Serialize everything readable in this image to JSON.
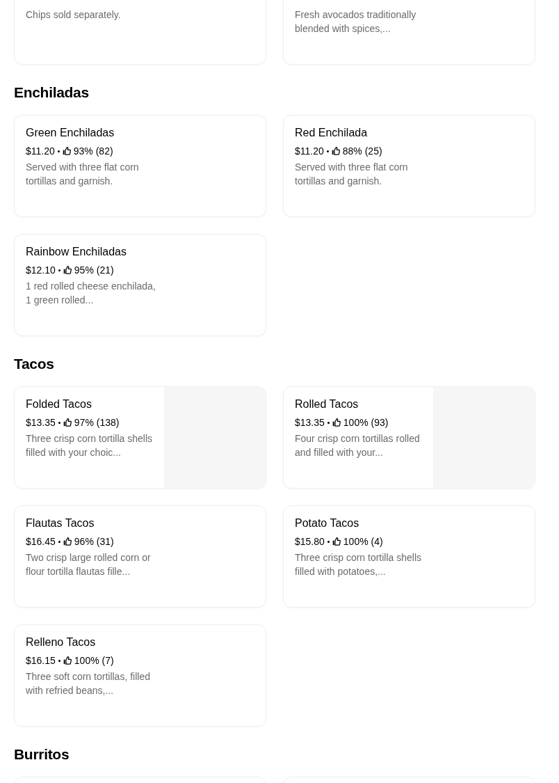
{
  "sections": [
    {
      "items": [
        {
          "description": "Chips sold separately.",
          "has_image": false
        },
        {
          "description": "Fresh avocados traditionally blended with spices,...",
          "has_image": false
        }
      ]
    },
    {
      "title": "Enchiladas",
      "items": [
        {
          "name": "Green Enchiladas",
          "price": "$11.20",
          "rating": "93% (82)",
          "description": "Served with three flat corn tortillas and garnish.",
          "has_image": false
        },
        {
          "name": "Red Enchilada",
          "price": "$11.20",
          "rating": "88% (25)",
          "description": "Served with three flat corn tortillas and garnish.",
          "has_image": false
        },
        {
          "name": "Rainbow Enchiladas",
          "price": "$12.10",
          "rating": "95% (21)",
          "description": "1 red rolled cheese enchilada, 1 green rolled...",
          "has_image": false
        }
      ]
    },
    {
      "title": "Tacos",
      "items": [
        {
          "name": "Folded Tacos",
          "price": "$13.35",
          "rating": "97% (138)",
          "description": "Three crisp corn tortilla shells filled with your choic...",
          "has_image": true
        },
        {
          "name": "Rolled Tacos",
          "price": "$13.35",
          "rating": "100% (93)",
          "description": "Four crisp corn tortillas rolled and filled with your...",
          "has_image": true
        },
        {
          "name": "Flautas Tacos",
          "price": "$16.45",
          "rating": "96% (31)",
          "description": "Two crisp large rolled corn or flour tortilla flautas fille...",
          "has_image": false
        },
        {
          "name": "Potato Tacos",
          "price": "$15.80",
          "rating": "100% (4)",
          "description": "Three crisp corn tortilla shells filled with potatoes,...",
          "has_image": false
        },
        {
          "name": "Relleno Tacos",
          "price": "$16.15",
          "rating": "100% (7)",
          "description": "Three soft corn tortillas, filled with refried beans,...",
          "has_image": false
        }
      ]
    },
    {
      "title": "Burritos"
    }
  ]
}
